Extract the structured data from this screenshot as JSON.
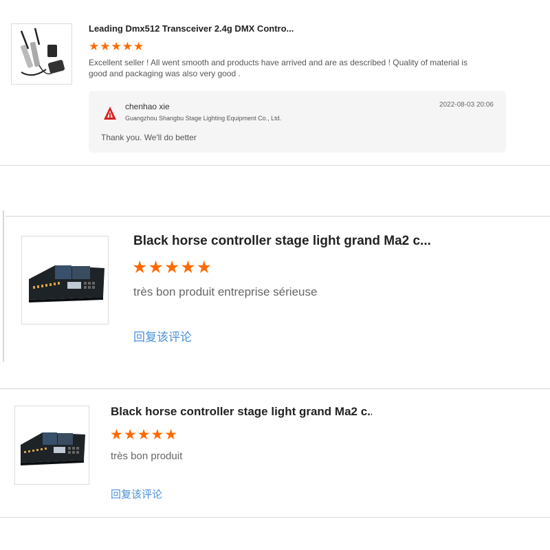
{
  "reviews": [
    {
      "product_title": "Leading Dmx512 Transceiver 2.4g DMX Contro...",
      "rating": 5,
      "stars": "★★★★★",
      "comment": "Excellent seller ! All went smooth and products have arrived and are as described ! Quality of material is good and packaging was also very good .",
      "thumbnail_icon": "dmx-transceiver-product-image",
      "seller_reply": {
        "name": "chenhao xie",
        "company": "Guangzhou Shangbu Stage Lighting Equipment Co., Ltd.",
        "date": "2022-08-03 20:06",
        "text": "Thank you. We'll do better",
        "logo_icon": "seller-logo-icon"
      }
    },
    {
      "product_title": "Black horse controller stage light grand Ma2 c...",
      "rating": 5,
      "stars": "★★★★★",
      "comment": "très bon produit entreprise sérieuse",
      "thumbnail_icon": "lighting-console-product-image",
      "reply_link": "回复该评论"
    },
    {
      "product_title": "Black horse controller stage light grand Ma2 c...",
      "rating": 5,
      "stars": "★★★★★",
      "comment": "très bon produit",
      "thumbnail_icon": "lighting-console-product-image",
      "reply_link": "回复该评论"
    }
  ],
  "colors": {
    "star": "#ff6a00",
    "link": "#4a90d9",
    "reply_bg": "#f5f5f5",
    "divider": "#d8d8d8"
  }
}
